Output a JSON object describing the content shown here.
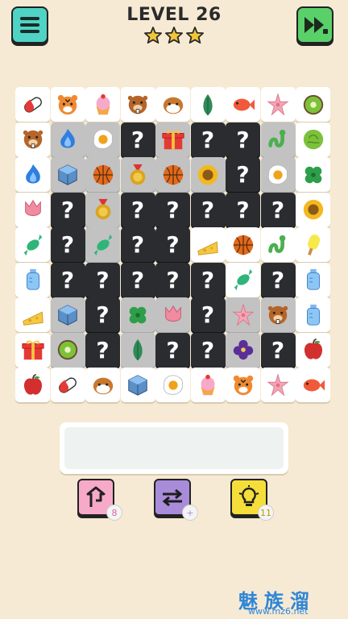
{
  "header": {
    "level_label": "LEVEL 26",
    "stars": 3,
    "menu_icon": "hamburger-menu-icon",
    "skip_icon": "fast-forward-ad-icon"
  },
  "board": {
    "rows": 9,
    "cols": 9,
    "hidden_glyph": "?",
    "tiles": [
      [
        "pill",
        "tiger",
        "cupcake",
        "beaver",
        "hamster",
        "leaf",
        "fish",
        "starflower",
        "kiwi"
      ],
      [
        "beaver",
        "flame:s",
        "egg:s",
        "?",
        "gift:s",
        "?",
        "?",
        "snake:s",
        "cabbage"
      ],
      [
        "flame",
        "cube:s",
        "basketball:s",
        "medal:s",
        "basketball:s",
        "sunflower:s",
        "?",
        "egg:s",
        "clover"
      ],
      [
        "tulip",
        "?",
        "medal:s",
        "?",
        "?",
        "?",
        "?",
        "?",
        "sunflower"
      ],
      [
        "candy",
        "?",
        "candy:s",
        "?",
        "?",
        "cheese",
        "basketball",
        "snake",
        "popsicle"
      ],
      [
        "bottle",
        "?",
        "?",
        "?",
        "?",
        "?",
        "candy",
        "?",
        "bottle"
      ],
      [
        "cheese",
        "cube:s",
        "?",
        "clover:s",
        "tulip:s",
        "?",
        "starflower:s",
        "beaver:s",
        "bottle"
      ],
      [
        "gift",
        "kiwi:s",
        "?",
        "leaf:s",
        "?",
        "?",
        "violet:s",
        "?",
        "apple"
      ],
      [
        "apple",
        "pill",
        "hamster",
        "cube",
        "egg",
        "cupcake",
        "tiger",
        "starflower",
        "fish"
      ]
    ]
  },
  "tray": {
    "slots": 0
  },
  "tools": [
    {
      "name": "undo",
      "icon": "undo-arrow-icon",
      "count": "8"
    },
    {
      "name": "shuffle",
      "icon": "shuffle-ad-icon",
      "count": "+"
    },
    {
      "name": "hint",
      "icon": "lightbulb-icon",
      "count": "11"
    }
  ],
  "watermark": {
    "brand": "魅族溜",
    "url": "www.mz6.net"
  }
}
